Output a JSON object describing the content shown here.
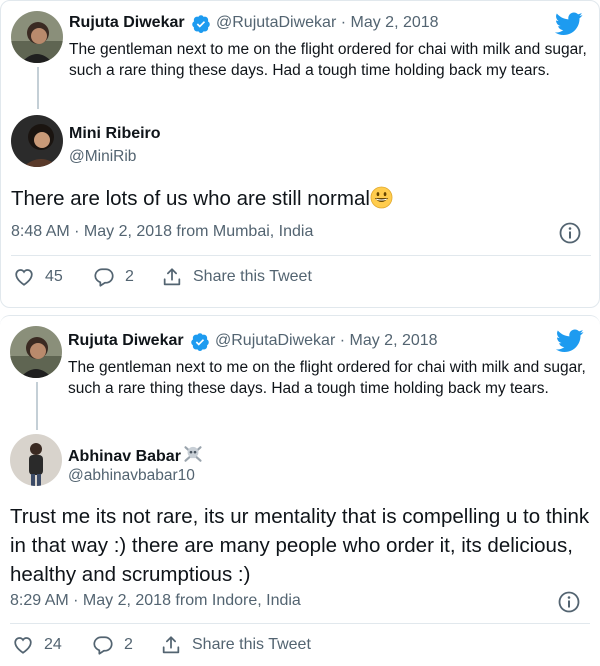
{
  "tweets": [
    {
      "parent": {
        "name": "Rujuta Diwekar",
        "meta": "@RujutaDiwekar · May 2, 2018",
        "text": "The gentleman next to me on the flight ordered for chai with milk and sugar, such a rare thing these days. Had a tough time holding back my tears."
      },
      "reply": {
        "name": "Mini Ribeiro",
        "handle": "@MiniRib",
        "text": "There are lots of us who are still normal",
        "timestamp": "8:48 AM · May 2, 2018 from Mumbai, India"
      },
      "actions": {
        "likes": "45",
        "replies": "2",
        "share_label": "Share this Tweet"
      }
    },
    {
      "parent": {
        "name": "Rujuta Diwekar",
        "meta": "@RujutaDiwekar · May 2, 2018",
        "text": "The gentleman next to me on the flight ordered for chai with milk and sugar, such a rare thing these days. Had a tough time holding back my tears."
      },
      "reply": {
        "name": "Abhinav Babar",
        "handle": "@abhinavbabar10",
        "text": "Trust me its not rare, its ur mentality that is compelling u to think in that way :) there are many people who order it, its delicious, healthy and scrumptious :)",
        "timestamp": "8:29 AM · May 2, 2018 from Indore, India"
      },
      "actions": {
        "likes": "24",
        "replies": "2",
        "share_label": "Share this Tweet"
      }
    }
  ],
  "colors": {
    "brand": "#1d9bf0",
    "text": "#0f1419",
    "muted": "#536471",
    "border": "#e1e8ed"
  }
}
